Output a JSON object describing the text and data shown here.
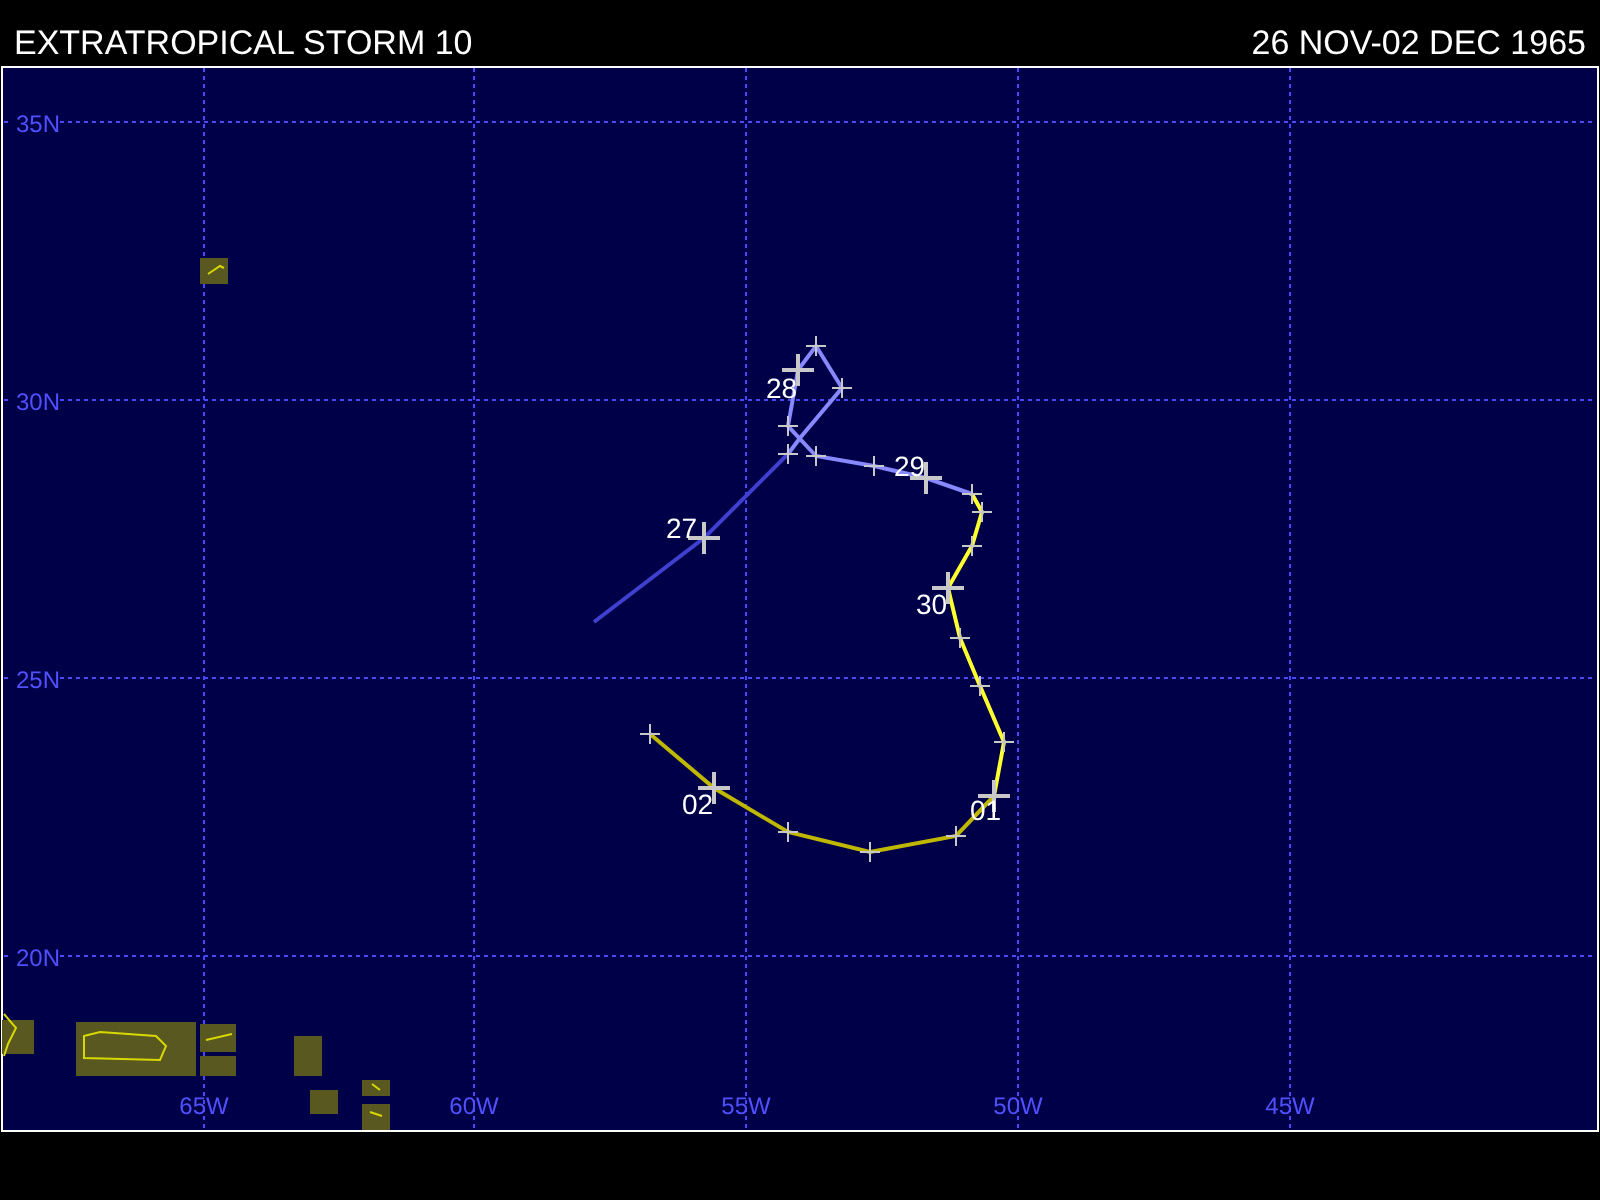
{
  "title": "EXTRATROPICAL STORM 10",
  "dates": "26 NOV-02 DEC 1965",
  "lat_labels": [
    "35N",
    "30N",
    "25N",
    "20N"
  ],
  "lon_labels": [
    "65W",
    "60W",
    "55W",
    "50W",
    "45W"
  ],
  "day_labels": [
    "27",
    "28",
    "29",
    "30",
    "01",
    "02"
  ]
}
